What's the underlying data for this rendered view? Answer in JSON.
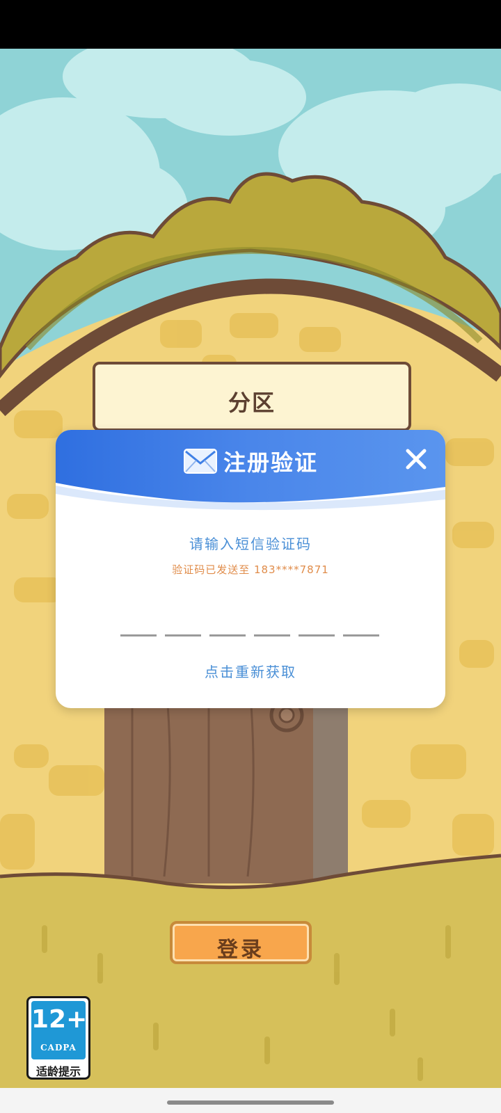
{
  "zone": {
    "label": "分区"
  },
  "dialog": {
    "title": "注册验证",
    "prompt": "请输入短信验证码",
    "sent_notice": "验证码已发送至 183****7871",
    "code_length": 6,
    "resend_label": "点击重新获取"
  },
  "login": {
    "label": "登录"
  },
  "age_badge": {
    "rating": "12+",
    "org": "CADPA",
    "caption": "适龄提示"
  },
  "colors": {
    "accent_blue": "#4a8fd6",
    "notice_orange": "#e08c4a",
    "login_orange": "#f8a64c",
    "header_blue": "#3f80e6",
    "badge_blue": "#1f98d6"
  },
  "icons": [
    "mail-icon",
    "close-icon"
  ]
}
